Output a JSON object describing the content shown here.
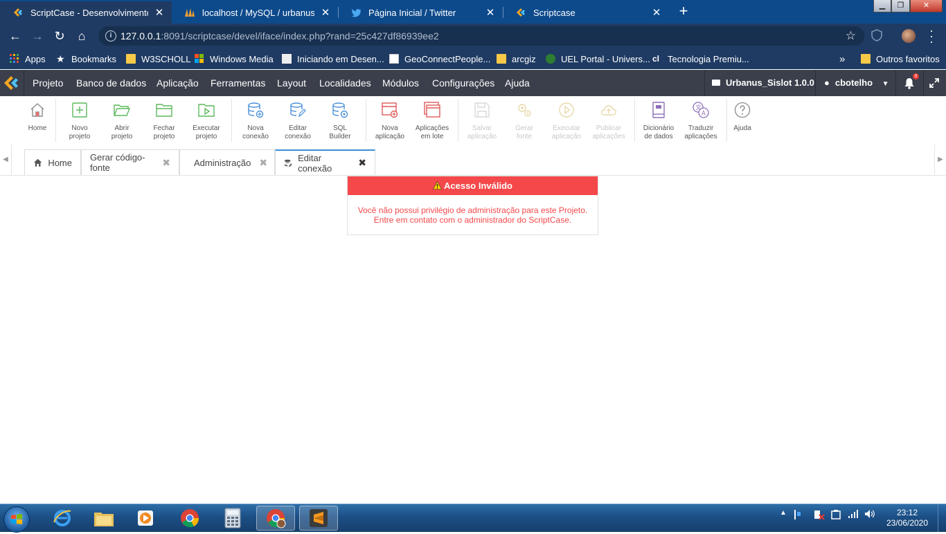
{
  "browser": {
    "tabs": [
      {
        "title": "ScriptCase - Desenvolvimento - c",
        "close": "✕"
      },
      {
        "title": "localhost / MySQL / urbanus_sislo",
        "close": "✕"
      },
      {
        "title": "Página Inicial / Twitter",
        "close": "✕"
      },
      {
        "title": "Scriptcase",
        "close": "✕"
      }
    ],
    "new_tab": "+",
    "url_host": "127.0.0.1",
    "url_rest": ":8091/scriptcase/devel/iface/index.php?rand=25c427df86939ee2"
  },
  "bookmarks": [
    {
      "label": "Apps",
      "icon": "apps-grid-icon"
    },
    {
      "label": "Bookmarks",
      "icon": "star-icon"
    },
    {
      "label": "W3SCHOLL",
      "icon": "folder-icon"
    },
    {
      "label": "Windows Media",
      "icon": "windows-icon"
    },
    {
      "label": "Iniciando em Desen...",
      "icon": "site-icon"
    },
    {
      "label": "GeoConnectPeople...",
      "icon": "site-icon"
    },
    {
      "label": "arcgiz",
      "icon": "folder-icon"
    },
    {
      "label": "UEL Portal - Univers...",
      "icon": "site-icon"
    },
    {
      "label": "Tecnologia Premiu...",
      "icon": "site-icon"
    }
  ],
  "bookmarks_more": "»",
  "bookmarks_other": "Outros favoritos",
  "menu": {
    "items": [
      "Projeto",
      "Banco de dados",
      "Aplicação",
      "Ferramentas",
      "Layout",
      "Localidades",
      "Módulos",
      "Configurações",
      "Ajuda"
    ],
    "project": "Urbanus_Sislot 1.0.0",
    "user": "cbotelho",
    "notifications": "0"
  },
  "toolbar": [
    {
      "line1": "Home",
      "line2": "",
      "icon": "home-icon"
    },
    {
      "line1": "Novo",
      "line2": "projeto",
      "icon": "new-project-icon"
    },
    {
      "line1": "Abrir",
      "line2": "projeto",
      "icon": "open-folder-icon"
    },
    {
      "line1": "Fechar",
      "line2": "projeto",
      "icon": "close-folder-icon"
    },
    {
      "line1": "Executar",
      "line2": "projeto",
      "icon": "run-project-icon"
    },
    {
      "line1": "Nova",
      "line2": "conexão",
      "icon": "new-connection-icon"
    },
    {
      "line1": "Editar",
      "line2": "conexão",
      "icon": "edit-connection-icon"
    },
    {
      "line1": "SQL",
      "line2": "Builder",
      "icon": "sql-builder-icon"
    },
    {
      "line1": "Nova",
      "line2": "aplicação",
      "icon": "new-app-icon"
    },
    {
      "line1": "Aplicações",
      "line2": "em lote",
      "icon": "batch-apps-icon"
    },
    {
      "line1": "Salvar",
      "line2": "aplicação",
      "icon": "save-icon"
    },
    {
      "line1": "Gerar",
      "line2": "fonte",
      "icon": "generate-icon"
    },
    {
      "line1": "Executar",
      "line2": "aplicação",
      "icon": "run-app-icon"
    },
    {
      "line1": "Publicar",
      "line2": "aplicações",
      "icon": "publish-icon"
    },
    {
      "line1": "Dicionário",
      "line2": "de dados",
      "icon": "dictionary-icon"
    },
    {
      "line1": "Traduzir",
      "line2": "aplicações",
      "icon": "translate-icon"
    },
    {
      "line1": "Ajuda",
      "line2": "",
      "icon": "help-icon"
    }
  ],
  "page_tabs": [
    {
      "label": "Home",
      "close": ""
    },
    {
      "label": "Gerar código-fonte",
      "close": "✖"
    },
    {
      "label": "Administração",
      "close": "✖"
    },
    {
      "label": "Editar conexão",
      "close": "✖"
    }
  ],
  "alert": {
    "title": "Acesso Inválido",
    "line1": "Você não possui privilégio de administração para este Projeto.",
    "line2": "Entre em contato com o administrador do ScriptCase."
  },
  "taskbar": {
    "time": "23:12",
    "date": "23/06/2020"
  }
}
